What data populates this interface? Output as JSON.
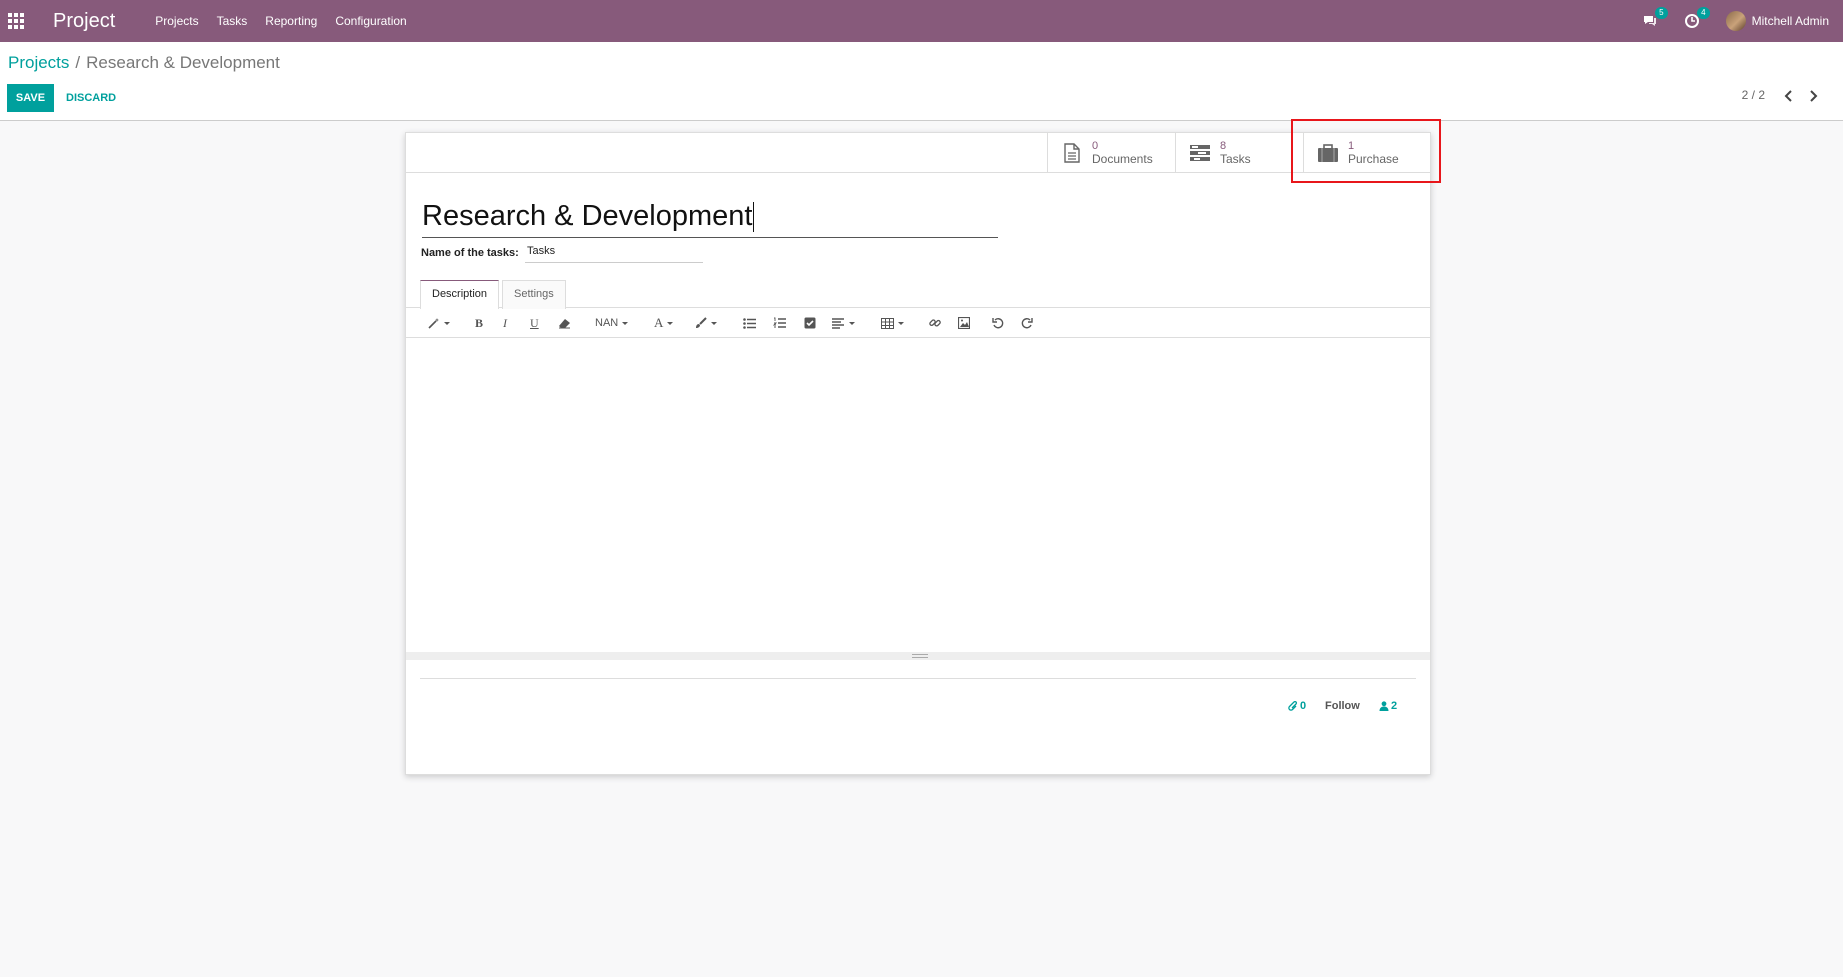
{
  "navbar": {
    "app_title": "Project",
    "menu": [
      "Projects",
      "Tasks",
      "Reporting",
      "Configuration"
    ],
    "messages_badge": "5",
    "activities_badge": "4",
    "user_name": "Mitchell Admin"
  },
  "breadcrumb": {
    "parent": "Projects",
    "separator": "/",
    "current": "Research & Development"
  },
  "actions": {
    "save": "SAVE",
    "discard": "DISCARD"
  },
  "pager": {
    "value": "2 / 2"
  },
  "smart_buttons": {
    "documents": {
      "value": "0",
      "label": "Documents"
    },
    "tasks": {
      "value": "8",
      "label": "Tasks"
    },
    "purchase": {
      "value": "1",
      "label": "Purchase"
    }
  },
  "form": {
    "project_name": "Research & Development",
    "tasks_label": "Name of the tasks:",
    "tasks_value": "Tasks"
  },
  "tabs": {
    "description": "Description",
    "settings": "Settings"
  },
  "toolbar": {
    "font_size": "NAN"
  },
  "chatter": {
    "attachments": "0",
    "follow": "Follow",
    "followers": "2"
  },
  "colors": {
    "brand": "#875a7b",
    "accent": "#00a09d",
    "highlight": "#e8161b"
  }
}
